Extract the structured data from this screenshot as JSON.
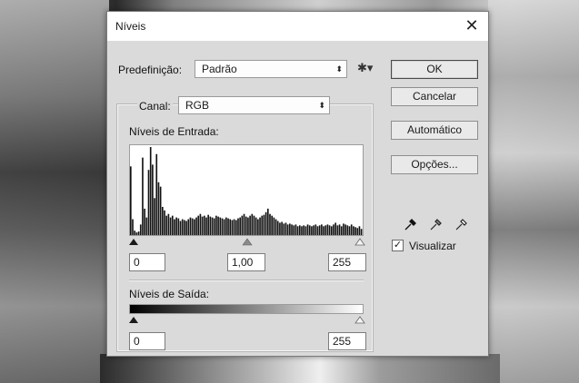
{
  "dialog": {
    "title": "Níveis",
    "close_glyph": "✕"
  },
  "preset": {
    "label": "Predefinição:",
    "value": "Padrão",
    "options_icon": "gear-icon"
  },
  "channel": {
    "label": "Canal:",
    "value": "RGB"
  },
  "input_levels": {
    "label": "Níveis de Entrada:",
    "black": "0",
    "gamma": "1,00",
    "white": "255"
  },
  "output_levels": {
    "label": "Níveis de Saída:",
    "black": "0",
    "white": "255"
  },
  "buttons": {
    "ok": "OK",
    "cancel": "Cancelar",
    "auto": "Automático",
    "options": "Opções..."
  },
  "eyedroppers": [
    "black-point-eyedropper-icon",
    "gray-point-eyedropper-icon",
    "white-point-eyedropper-icon"
  ],
  "preview": {
    "label": "Visualizar",
    "checked": true
  },
  "histogram": {
    "note_values_are_relative_bar_heights_0_to_1": true,
    "bars": [
      0.78,
      0.18,
      0.05,
      0.03,
      0.04,
      0.12,
      0.88,
      0.3,
      0.2,
      0.74,
      1.0,
      0.8,
      0.42,
      0.92,
      0.6,
      0.55,
      0.32,
      0.28,
      0.22,
      0.24,
      0.2,
      0.22,
      0.18,
      0.2,
      0.19,
      0.16,
      0.18,
      0.17,
      0.16,
      0.18,
      0.2,
      0.19,
      0.18,
      0.2,
      0.22,
      0.24,
      0.21,
      0.22,
      0.2,
      0.23,
      0.21,
      0.2,
      0.19,
      0.22,
      0.21,
      0.2,
      0.19,
      0.18,
      0.2,
      0.19,
      0.18,
      0.17,
      0.18,
      0.17,
      0.19,
      0.2,
      0.22,
      0.24,
      0.21,
      0.2,
      0.22,
      0.24,
      0.22,
      0.2,
      0.18,
      0.2,
      0.22,
      0.23,
      0.26,
      0.3,
      0.24,
      0.22,
      0.2,
      0.18,
      0.16,
      0.14,
      0.15,
      0.13,
      0.14,
      0.12,
      0.13,
      0.12,
      0.11,
      0.12,
      0.1,
      0.11,
      0.1,
      0.11,
      0.1,
      0.12,
      0.11,
      0.1,
      0.11,
      0.12,
      0.1,
      0.11,
      0.12,
      0.1,
      0.11,
      0.12,
      0.11,
      0.1,
      0.12,
      0.14,
      0.11,
      0.12,
      0.1,
      0.13,
      0.12,
      0.11,
      0.1,
      0.12,
      0.1,
      0.09,
      0.08,
      0.1,
      0.07
    ]
  }
}
